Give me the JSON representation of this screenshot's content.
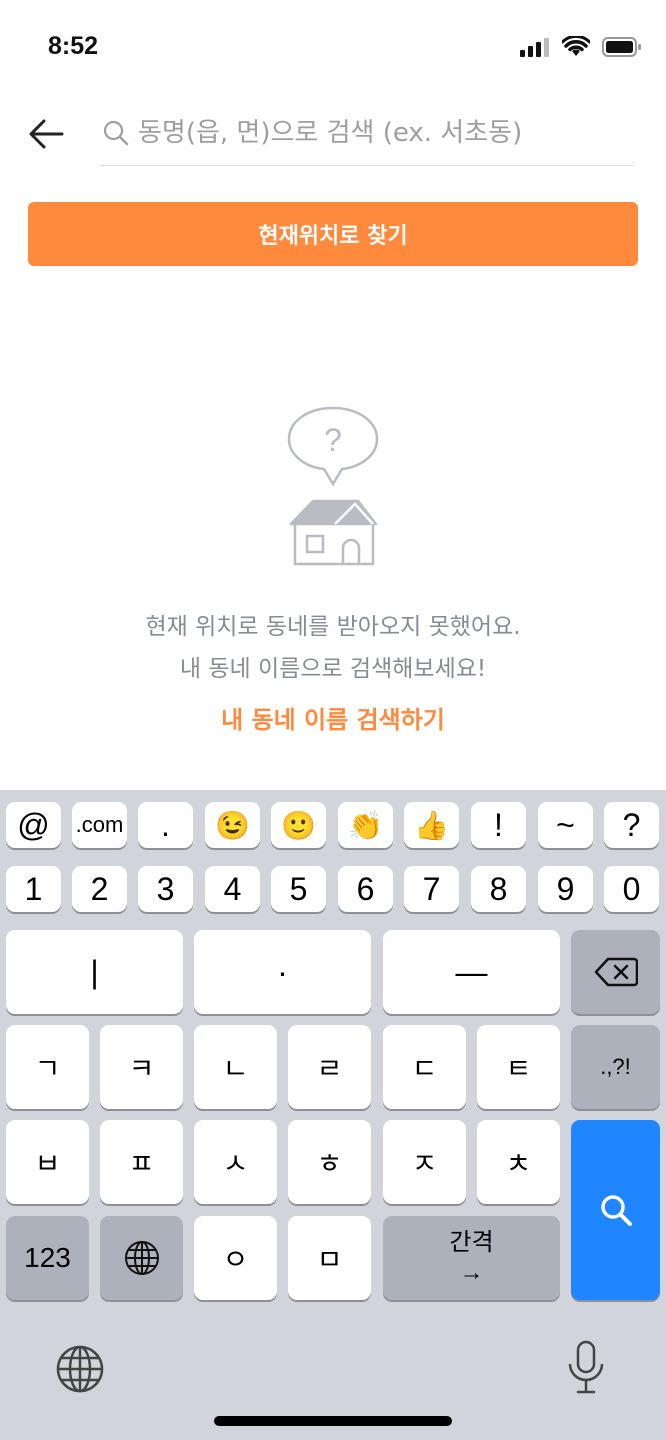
{
  "status": {
    "time": "8:52"
  },
  "search": {
    "placeholder": "동명(읍, 면)으로 검색 (ex. 서초동)",
    "value": ""
  },
  "locate_button": {
    "label": "현재위치로 찾기"
  },
  "empty_state": {
    "line1": "현재 위치로 동네를 받아오지 못했어요.",
    "line2": "내 동네 이름으로 검색해보세요!",
    "link": "내 동네 이름 검색하기"
  },
  "colors": {
    "accent": "#ff8a3d",
    "key_blue": "#1f86ff",
    "keyboard_bg": "#d1d4da"
  },
  "keyboard": {
    "row1": [
      "@",
      ".com",
      ".",
      "😉",
      "🙂",
      "👏",
      "👍",
      "!",
      "~",
      "?"
    ],
    "row2": [
      "1",
      "2",
      "3",
      "4",
      "5",
      "6",
      "7",
      "8",
      "9",
      "0"
    ],
    "row3": [
      "|",
      "·",
      "—"
    ],
    "row4": [
      "ㄱ",
      "ㅋ",
      "ㄴ",
      "ㄹ",
      "ㄷ",
      "ㅌ"
    ],
    "punct": ".,?!",
    "row5": [
      "ㅂ",
      "ㅍ",
      "ㅅ",
      "ㅎ",
      "ㅈ",
      "ㅊ"
    ],
    "numbers_key": "123",
    "row6": [
      "ㅇ",
      "ㅁ"
    ],
    "space_label": "간격",
    "space_arrow": "→"
  }
}
